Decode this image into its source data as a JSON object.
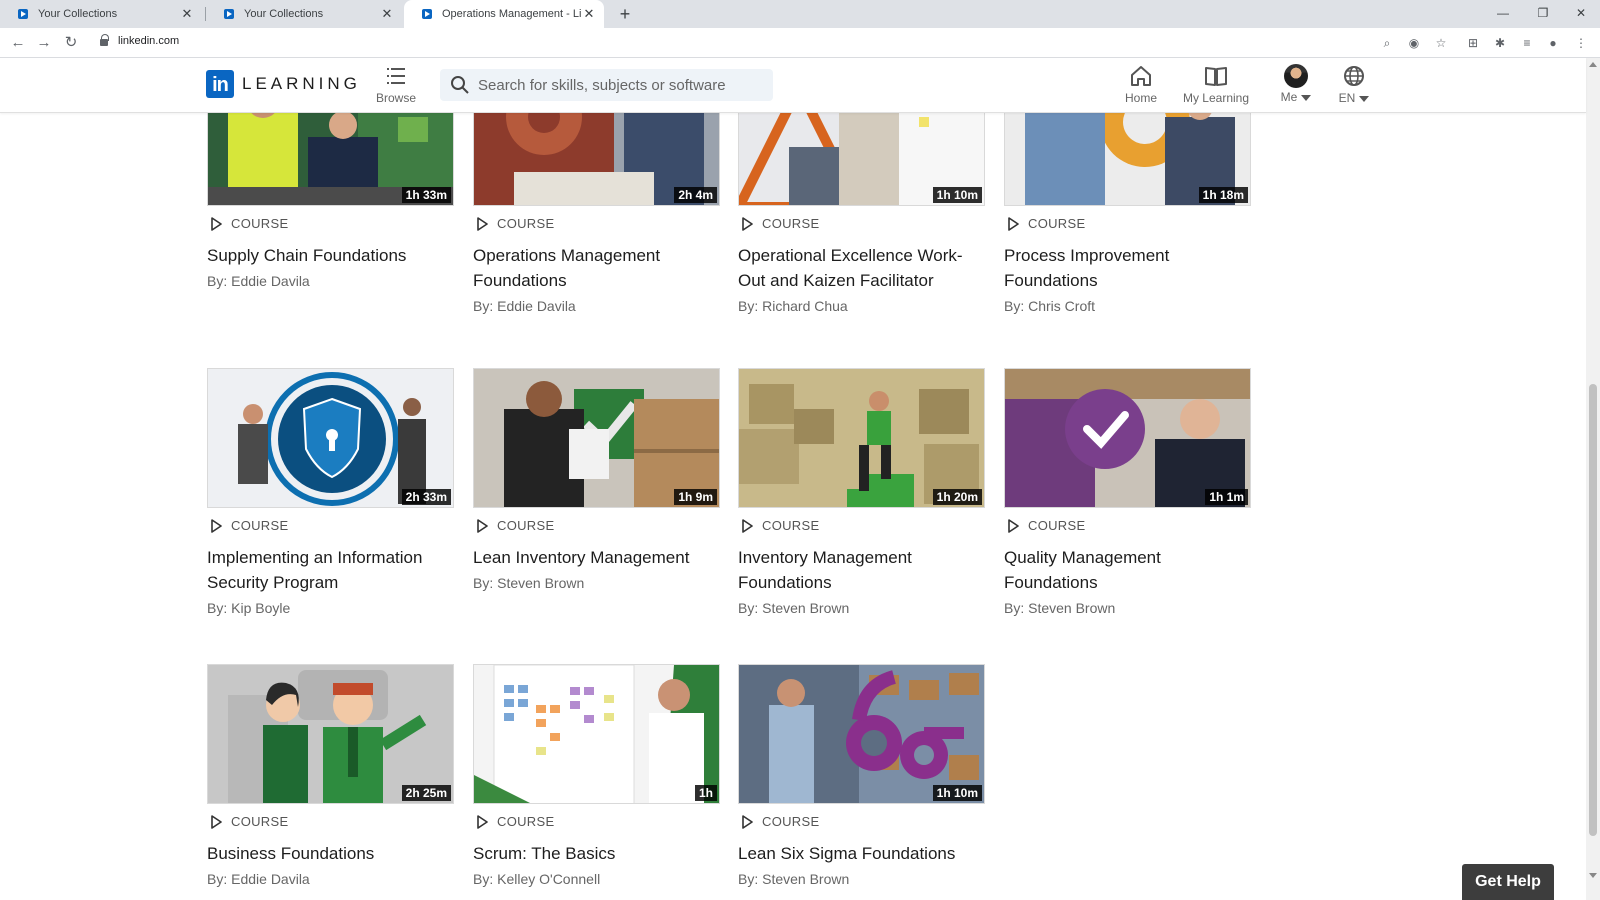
{
  "browser": {
    "tabs": [
      {
        "label": "Your Collections"
      },
      {
        "label": "Your Collections"
      },
      {
        "label": "Operations Management - Linke"
      }
    ],
    "url": "linkedin.com"
  },
  "header": {
    "logo_text": "in",
    "logo_word": "LEARNING",
    "browse_label": "Browse",
    "search_placeholder": "Search for skills, subjects or software",
    "home_label": "Home",
    "my_learning_label": "My Learning",
    "me_label": "Me",
    "lang_label": "EN"
  },
  "courses": [
    {
      "type": "COURSE",
      "title": "Supply Chain Foundations",
      "author": "By: Eddie Davila",
      "duration": "1h 33m"
    },
    {
      "type": "COURSE",
      "title": "Operations Management Foundations",
      "author": "By: Eddie Davila",
      "duration": "2h 4m"
    },
    {
      "type": "COURSE",
      "title": "Operational Excellence Work-Out and Kaizen Facilitator",
      "author": "By: Richard Chua",
      "duration": "1h 10m"
    },
    {
      "type": "COURSE",
      "title": "Process Improvement Foundations",
      "author": "By: Chris Croft",
      "duration": "1h 18m"
    },
    {
      "type": "COURSE",
      "title": "Implementing an Information Security Program",
      "author": "By: Kip Boyle",
      "duration": "2h 33m"
    },
    {
      "type": "COURSE",
      "title": "Lean Inventory Management",
      "author": "By: Steven Brown",
      "duration": "1h 9m"
    },
    {
      "type": "COURSE",
      "title": "Inventory Management Foundations",
      "author": "By: Steven Brown",
      "duration": "1h 20m"
    },
    {
      "type": "COURSE",
      "title": "Quality Management Foundations",
      "author": "By: Steven Brown",
      "duration": "1h 1m"
    },
    {
      "type": "COURSE",
      "title": "Business Foundations",
      "author": "By: Eddie Davila",
      "duration": "2h 25m"
    },
    {
      "type": "COURSE",
      "title": "Scrum: The Basics",
      "author": "By: Kelley O'Connell",
      "duration": "1h"
    },
    {
      "type": "COURSE",
      "title": "Lean Six Sigma Foundations",
      "author": "By: Steven Brown",
      "duration": "1h 10m"
    }
  ],
  "get_help_label": "Get Help",
  "colors": {
    "brand": "#0a66c2",
    "search_bg": "#eef3f8"
  }
}
